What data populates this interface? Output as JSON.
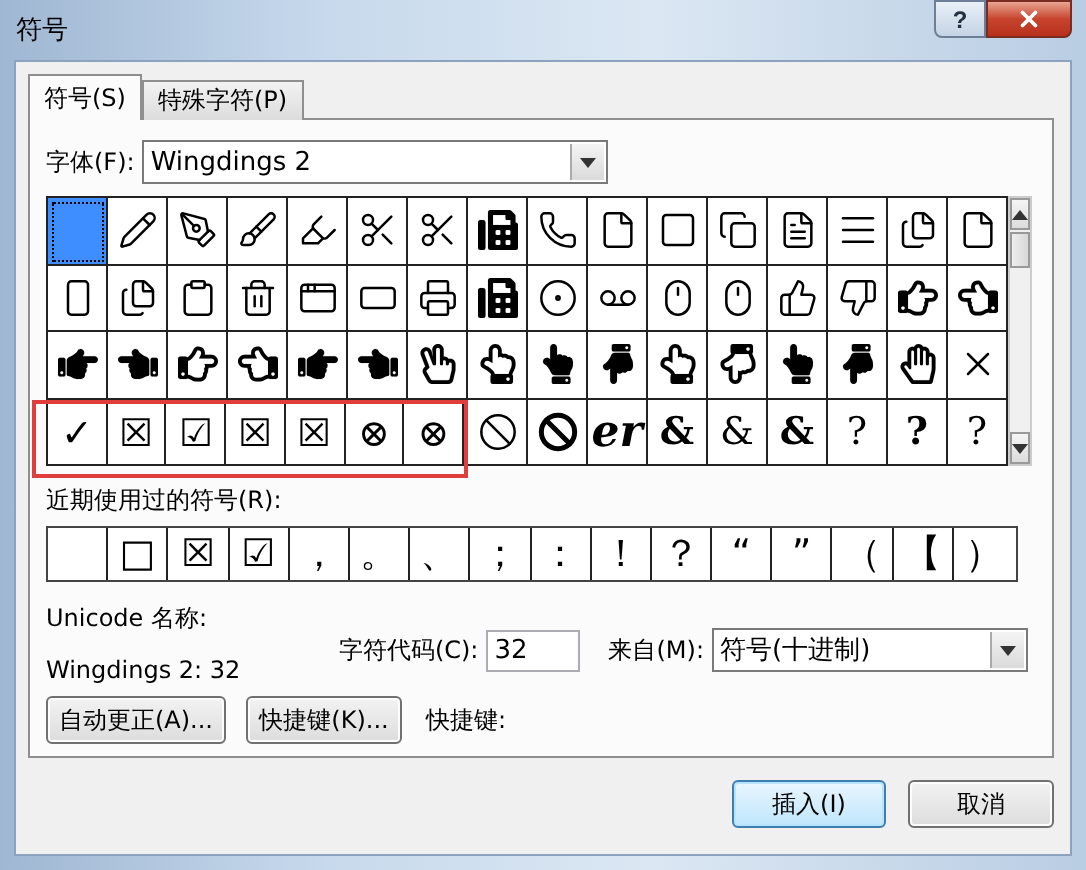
{
  "window": {
    "title": "符号",
    "help_button": "?"
  },
  "tabs": [
    {
      "label": "符号(S)",
      "selected": true
    },
    {
      "label": "特殊字符(P)",
      "selected": false
    }
  ],
  "font": {
    "label": "字体(F):",
    "value": "Wingdings 2"
  },
  "symbol_grid": {
    "rows": [
      {
        "cells": [
          {
            "kind": "icon",
            "selected": true,
            "highlighted": false
          },
          {
            "kind": "icon",
            "selected": false,
            "highlighted": false
          },
          {
            "kind": "icon",
            "selected": false,
            "highlighted": false
          },
          {
            "kind": "icon",
            "selected": false,
            "highlighted": false
          },
          {
            "kind": "icon",
            "selected": false,
            "highlighted": false
          },
          {
            "kind": "icon",
            "selected": false,
            "highlighted": false
          },
          {
            "kind": "icon",
            "selected": false,
            "highlighted": false
          },
          {
            "kind": "icon",
            "selected": false,
            "highlighted": false
          },
          {
            "kind": "icon",
            "selected": false,
            "highlighted": false
          },
          {
            "kind": "icon",
            "selected": false,
            "highlighted": false
          },
          {
            "kind": "icon",
            "selected": false,
            "highlighted": false
          },
          {
            "kind": "icon",
            "selected": false,
            "highlighted": false
          },
          {
            "kind": "icon",
            "selected": false,
            "highlighted": false
          },
          {
            "kind": "icon",
            "selected": false,
            "highlighted": false
          },
          {
            "kind": "icon",
            "selected": false,
            "highlighted": false
          },
          {
            "kind": "icon",
            "selected": false,
            "highlighted": false
          }
        ]
      },
      {
        "cells": [
          {
            "kind": "icon",
            "selected": false,
            "highlighted": false
          },
          {
            "kind": "icon",
            "selected": false,
            "highlighted": false
          },
          {
            "kind": "icon",
            "selected": false,
            "highlighted": false
          },
          {
            "kind": "icon",
            "selected": false,
            "highlighted": false
          },
          {
            "kind": "icon",
            "selected": false,
            "highlighted": false
          },
          {
            "kind": "icon",
            "selected": false,
            "highlighted": false
          },
          {
            "kind": "icon",
            "selected": false,
            "highlighted": false
          },
          {
            "kind": "icon",
            "selected": false,
            "highlighted": false
          },
          {
            "kind": "icon",
            "selected": false,
            "highlighted": false
          },
          {
            "kind": "icon",
            "selected": false,
            "highlighted": false
          },
          {
            "kind": "icon",
            "selected": false,
            "highlighted": false
          },
          {
            "kind": "icon",
            "selected": false,
            "highlighted": false
          },
          {
            "kind": "icon",
            "selected": false,
            "highlighted": false
          },
          {
            "kind": "icon",
            "selected": false,
            "highlighted": false
          },
          {
            "kind": "icon",
            "selected": false,
            "highlighted": false
          },
          {
            "kind": "icon",
            "selected": false,
            "highlighted": false
          }
        ]
      },
      {
        "cells": [
          {
            "kind": "icon",
            "selected": false,
            "highlighted": false
          },
          {
            "kind": "icon",
            "selected": false,
            "highlighted": false
          },
          {
            "kind": "icon",
            "selected": false,
            "highlighted": false
          },
          {
            "kind": "icon",
            "selected": false,
            "highlighted": false
          },
          {
            "kind": "icon",
            "selected": false,
            "highlighted": false
          },
          {
            "kind": "icon",
            "selected": false,
            "highlighted": false
          },
          {
            "kind": "icon",
            "selected": false,
            "highlighted": false
          },
          {
            "kind": "icon",
            "selected": false,
            "highlighted": false
          },
          {
            "kind": "icon",
            "selected": false,
            "highlighted": false
          },
          {
            "kind": "icon",
            "selected": false,
            "highlighted": false
          },
          {
            "kind": "icon",
            "selected": false,
            "highlighted": false
          },
          {
            "kind": "icon",
            "selected": false,
            "highlighted": false
          },
          {
            "kind": "icon",
            "selected": false,
            "highlighted": false
          },
          {
            "kind": "icon",
            "selected": false,
            "highlighted": false
          },
          {
            "kind": "icon",
            "selected": false,
            "highlighted": false
          },
          {
            "kind": "icon",
            "selected": false,
            "highlighted": false
          }
        ]
      },
      {
        "cells": [
          {
            "kind": "glyph",
            "text": "✓",
            "selected": false,
            "highlighted": true
          },
          {
            "kind": "glyph",
            "text": "☒",
            "selected": false,
            "highlighted": true
          },
          {
            "kind": "glyph",
            "text": "☑",
            "selected": false,
            "highlighted": true
          },
          {
            "kind": "glyph",
            "text": "☒",
            "selected": false,
            "highlighted": true
          },
          {
            "kind": "glyph",
            "text": "☒",
            "selected": false,
            "highlighted": true
          },
          {
            "kind": "glyph",
            "text": "⊗",
            "selected": false,
            "highlighted": true
          },
          {
            "kind": "glyph",
            "text": "⊗",
            "selected": false,
            "highlighted": true
          },
          {
            "kind": "icon",
            "selected": false,
            "highlighted": false
          },
          {
            "kind": "icon",
            "selected": false,
            "highlighted": false
          },
          {
            "kind": "glyph",
            "text": "er",
            "selected": false,
            "highlighted": false
          },
          {
            "kind": "glyph",
            "text": "&",
            "selected": false,
            "highlighted": false
          },
          {
            "kind": "glyph",
            "text": "&",
            "selected": false,
            "highlighted": false
          },
          {
            "kind": "glyph",
            "text": "&",
            "selected": false,
            "highlighted": false
          },
          {
            "kind": "glyph",
            "text": "?",
            "selected": false,
            "highlighted": false
          },
          {
            "kind": "glyph",
            "text": "?",
            "selected": false,
            "highlighted": false
          },
          {
            "kind": "glyph",
            "text": "?",
            "selected": false,
            "highlighted": false
          }
        ]
      }
    ]
  },
  "recent": {
    "label": "近期使用过的符号(R):",
    "cells": [
      {
        "kind": "empty"
      },
      {
        "kind": "glyph",
        "text": "□"
      },
      {
        "kind": "glyph",
        "text": "☒"
      },
      {
        "kind": "glyph",
        "text": "☑"
      },
      {
        "kind": "glyph",
        "text": "，"
      },
      {
        "kind": "glyph",
        "text": "。"
      },
      {
        "kind": "glyph",
        "text": "、"
      },
      {
        "kind": "glyph",
        "text": "；"
      },
      {
        "kind": "glyph",
        "text": "："
      },
      {
        "kind": "glyph",
        "text": "！"
      },
      {
        "kind": "glyph",
        "text": "？"
      },
      {
        "kind": "glyph",
        "text": "“"
      },
      {
        "kind": "glyph",
        "text": "”"
      },
      {
        "kind": "glyph",
        "text": "（"
      },
      {
        "kind": "glyph",
        "text": "【"
      },
      {
        "kind": "glyph",
        "text": "）"
      }
    ]
  },
  "unicode_name": {
    "label": "Unicode 名称:",
    "value": "Wingdings 2: 32"
  },
  "char_code": {
    "label": "字符代码(C):",
    "value": "32"
  },
  "from": {
    "label": "来自(M):",
    "value": "符号(十进制)"
  },
  "actions": [
    {
      "label": "自动更正(A)..."
    },
    {
      "label": "快捷键(K)..."
    }
  ],
  "shortcut_label": "快捷键:",
  "buttons": [
    {
      "label": "插入(I)",
      "default": true
    },
    {
      "label": "取消",
      "default": false
    }
  ]
}
